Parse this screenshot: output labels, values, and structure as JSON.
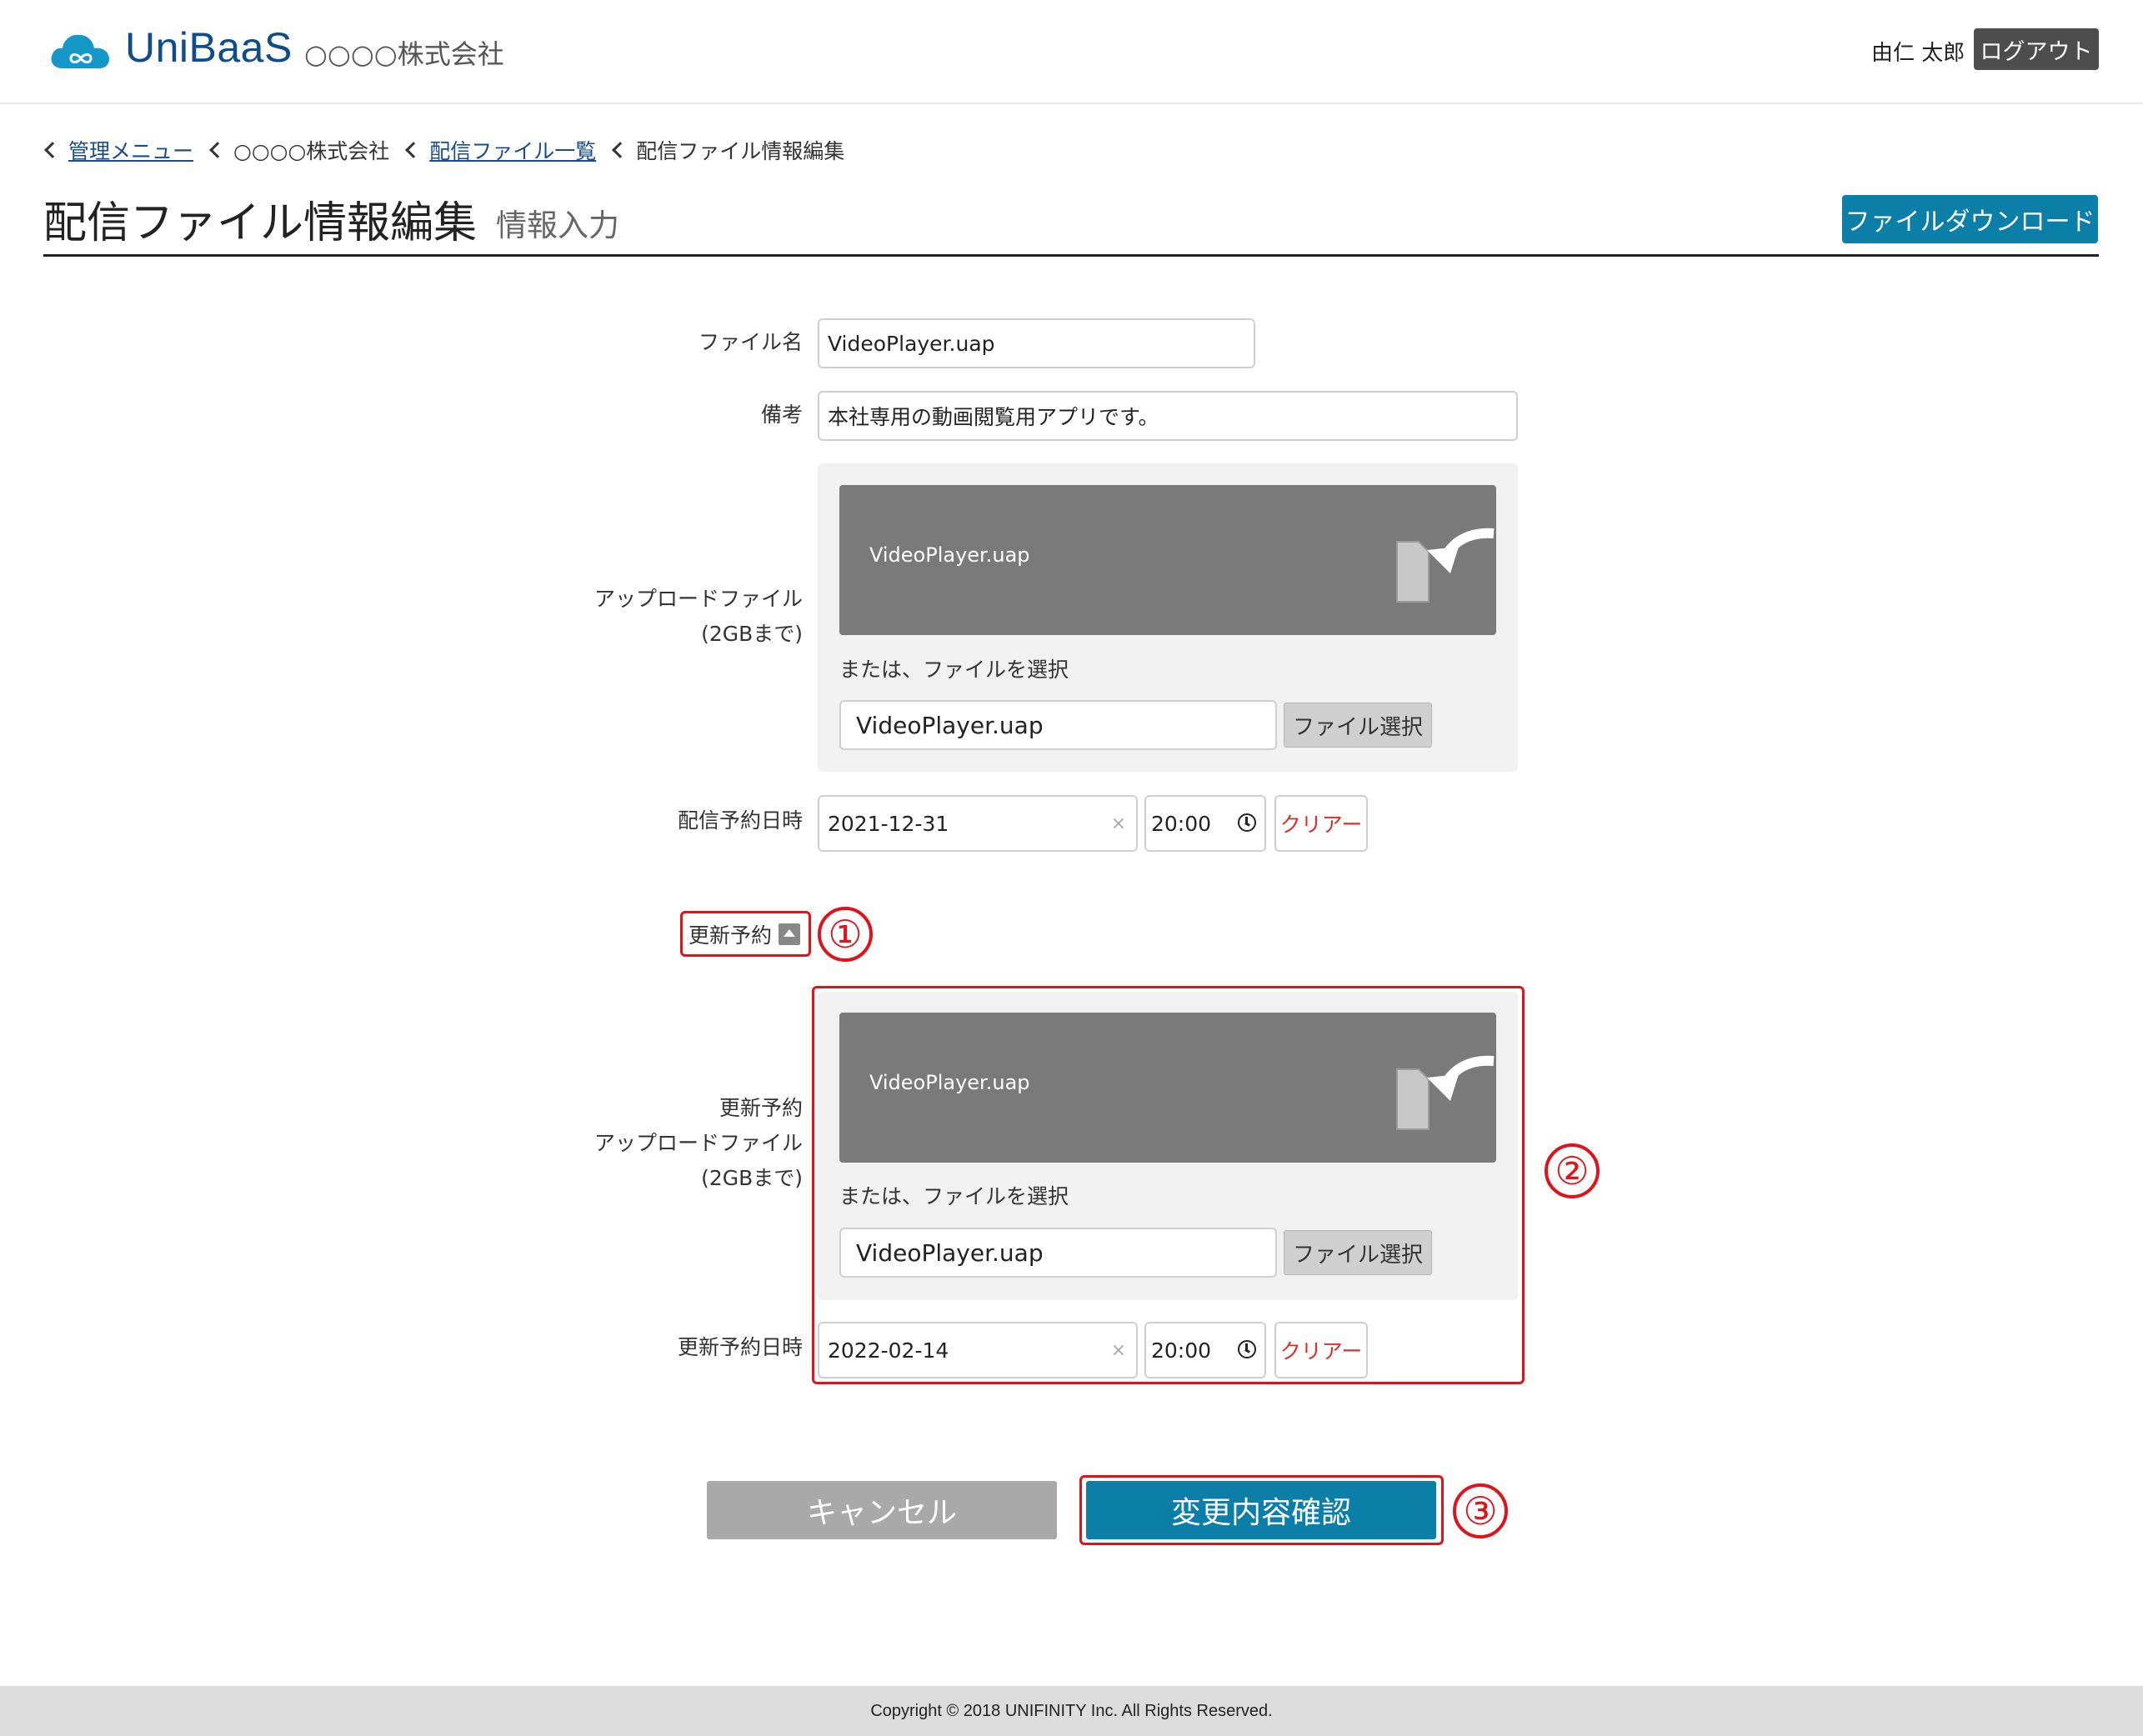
{
  "header": {
    "brand": "UniBaaS",
    "company": "○○○○株式会社",
    "user_name": "由仁 太郎",
    "logout_label": "ログアウト"
  },
  "breadcrumb": [
    {
      "label": "管理メニュー",
      "link": true
    },
    {
      "label": "○○○○株式会社",
      "link": false
    },
    {
      "label": "配信ファイル一覧",
      "link": true
    },
    {
      "label": "配信ファイル情報編集",
      "link": false
    }
  ],
  "page": {
    "title": "配信ファイル情報編集",
    "subtitle": "情報入力",
    "download_label": "ファイルダウンロード"
  },
  "form": {
    "file_name_label": "ファイル名",
    "file_name_value": "VideoPlayer.uap",
    "note_label": "備考",
    "note_value": "本社専用の動画閲覧用アプリです。",
    "upload_label_1": "アップロードファイル",
    "upload_label_2": "(2GBまで)",
    "upload_drop_name": "VideoPlayer.uap",
    "or_select_text": "または、ファイルを選択",
    "upload_file_value": "VideoPlayer.uap",
    "select_file_label": "ファイル選択",
    "schedule_label": "配信予約日時",
    "schedule_date": "2021-12-31",
    "schedule_time": "20:00",
    "clear_label": "クリアー",
    "clear_x": "×",
    "update_toggle_label": "更新予約",
    "update_upload_label_1": "更新予約",
    "update_upload_label_2": "アップロードファイル",
    "update_upload_label_3": "(2GBまで)",
    "update_drop_name": "VideoPlayer.uap",
    "update_or_select_text": "または、ファイルを選択",
    "update_file_value": "VideoPlayer.uap",
    "update_select_file_label": "ファイル選択",
    "update_schedule_label": "更新予約日時",
    "update_schedule_date": "2022-02-14",
    "update_schedule_time": "20:00",
    "update_clear_label": "クリアー"
  },
  "actions": {
    "cancel_label": "キャンセル",
    "confirm_label": "変更内容確認"
  },
  "annotations": {
    "n1": "①",
    "n2": "②",
    "n3": "③",
    "color": "#e0121b"
  },
  "footer": {
    "copyright": "Copyright © 2018 UNIFINITY Inc. All Rights Reserved."
  },
  "colors": {
    "brand": "#0e4d8a",
    "primary_button": "#0b7fa8",
    "logout_button": "#4d4d4d",
    "cancel_button": "#a9a9a9",
    "drop_zone": "#7a7a7a",
    "clear_text": "#d9302b"
  }
}
